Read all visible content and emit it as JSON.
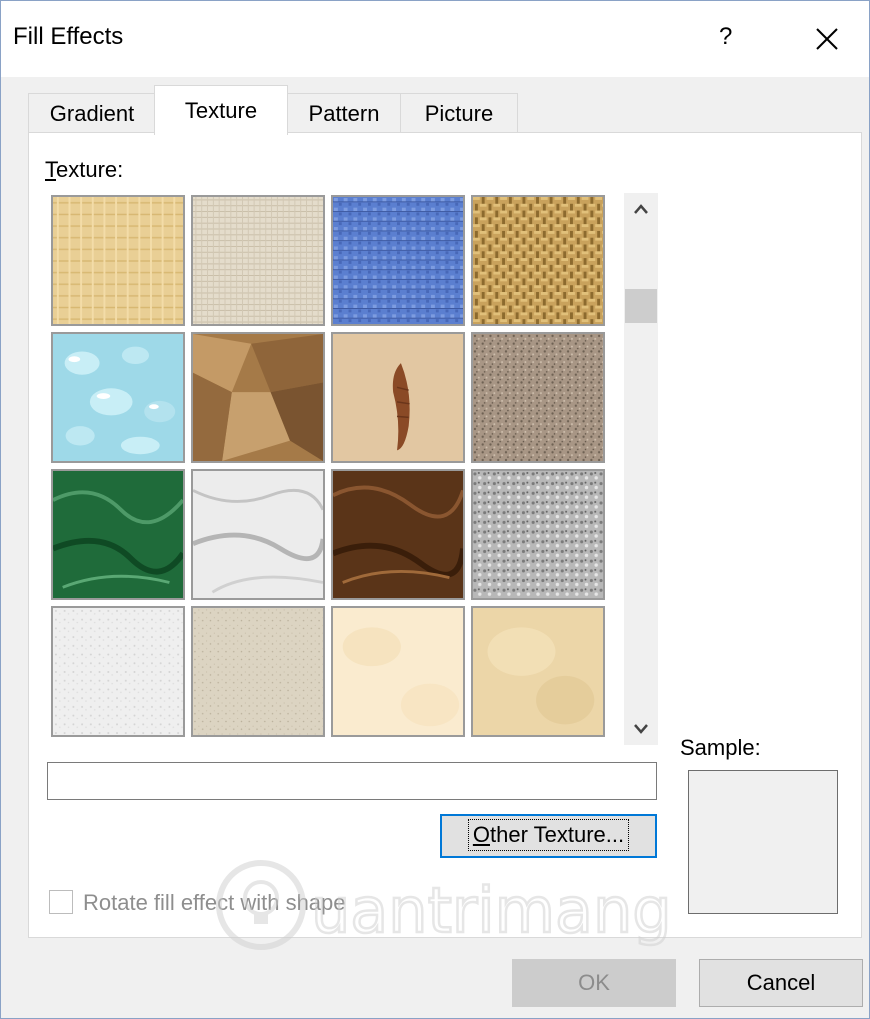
{
  "window": {
    "title": "Fill Effects",
    "help": "?"
  },
  "tabs": [
    {
      "label": "Gradient",
      "active": false
    },
    {
      "label": "Texture",
      "active": true
    },
    {
      "label": "Pattern",
      "active": false
    },
    {
      "label": "Picture",
      "active": false
    }
  ],
  "texture_panel": {
    "label_accel": "T",
    "label_rest": "exture:",
    "selected_texture_name": "",
    "textures": [
      "papyrus",
      "canvas",
      "denim",
      "woven-mat",
      "water-droplets",
      "paper-bag",
      "fish-fossil",
      "sand",
      "green-marble",
      "white-marble",
      "brown-marble",
      "granite",
      "newsprint",
      "recycled-paper",
      "parchment",
      "stationery"
    ],
    "other_texture_button": {
      "accel": "O",
      "rest": "ther Texture..."
    }
  },
  "sample": {
    "label": "Sample:"
  },
  "rotate_checkbox": {
    "label": "Rotate fill effect with shape",
    "checked": false,
    "enabled": false
  },
  "buttons": {
    "ok": "OK",
    "cancel": "Cancel"
  },
  "watermark": {
    "text": "uantrimang"
  },
  "colors": {
    "accent": "#0078d7",
    "dialog_bg": "#f0f0f0",
    "panel_bg": "#ffffff"
  }
}
